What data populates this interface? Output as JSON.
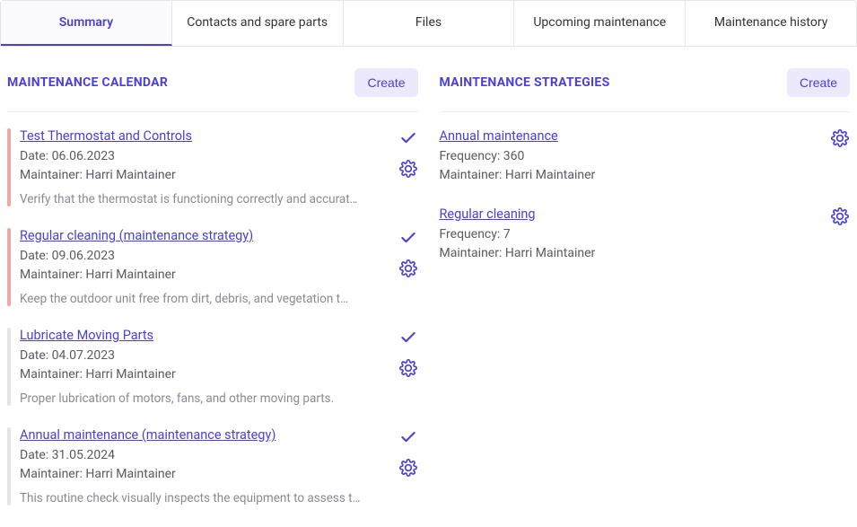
{
  "tabs": [
    {
      "label": "Summary",
      "active": true
    },
    {
      "label": "Contacts and spare parts",
      "active": false
    },
    {
      "label": "Files",
      "active": false
    },
    {
      "label": "Upcoming maintenance",
      "active": false
    },
    {
      "label": "Maintenance history",
      "active": false
    }
  ],
  "calendar": {
    "title": "MAINTENANCE CALENDAR",
    "create_label": "Create",
    "date_label_prefix": "Date: ",
    "maintainer_label_prefix": "Maintainer: ",
    "items": [
      {
        "title": "Test Thermostat and Controls",
        "date": "06.06.2023",
        "maintainer": "Harri Maintainer",
        "desc": "Verify that the thermostat is functioning correctly and accurat…",
        "bar": "overdue"
      },
      {
        "title": "Regular cleaning (maintenance strategy)",
        "date": "09.06.2023",
        "maintainer": "Harri Maintainer",
        "desc": "Keep the outdoor unit free from dirt, debris, and vegetation t…",
        "bar": "overdue"
      },
      {
        "title": "Lubricate Moving Parts",
        "date": "04.07.2023",
        "maintainer": "Harri Maintainer",
        "desc": "Proper lubrication of motors, fans, and other moving parts.",
        "bar": "normal"
      },
      {
        "title": "Annual maintenance (maintenance strategy)",
        "date": "31.05.2024",
        "maintainer": "Harri Maintainer",
        "desc": "This routine check visually inspects the equipment to assess t…",
        "bar": "normal"
      }
    ]
  },
  "strategies": {
    "title": "MAINTENANCE STRATEGIES",
    "create_label": "Create",
    "freq_label_prefix": "Frequency: ",
    "maintainer_label_prefix": "Maintainer: ",
    "items": [
      {
        "title": "Annual maintenance",
        "frequency": "360",
        "maintainer": "Harri Maintainer"
      },
      {
        "title": "Regular cleaning",
        "frequency": "7",
        "maintainer": "Harri Maintainer"
      }
    ]
  }
}
